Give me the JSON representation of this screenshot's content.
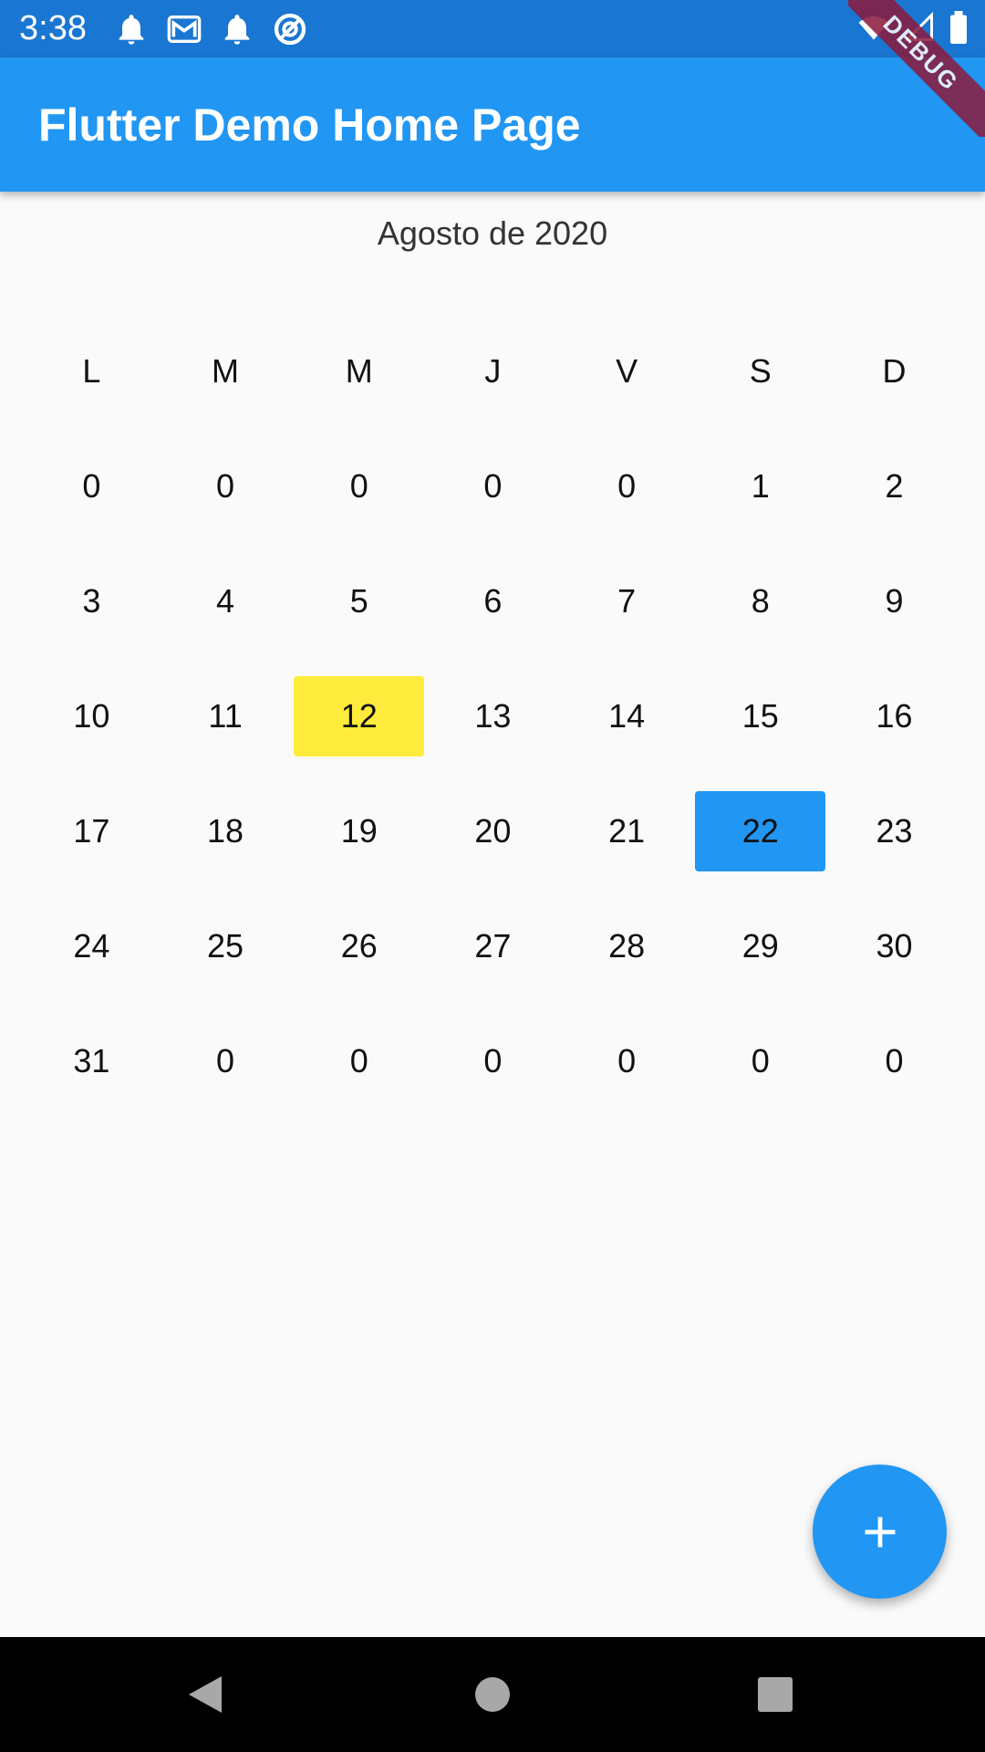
{
  "status_bar": {
    "time": "3:38",
    "left_icons": [
      "notification-bell-icon",
      "gmail-icon",
      "notification-bell-icon",
      "circle-slash-icon"
    ],
    "right_icons": [
      "wifi-icon",
      "signal-icon",
      "battery-icon"
    ]
  },
  "app_bar": {
    "title": "Flutter Demo Home Page"
  },
  "debug_banner": "DEBUG",
  "calendar": {
    "month_title": "Agosto de 2020",
    "weekdays": [
      "L",
      "M",
      "M",
      "J",
      "V",
      "S",
      "D"
    ],
    "weeks": [
      [
        "0",
        "0",
        "0",
        "0",
        "0",
        "1",
        "2"
      ],
      [
        "3",
        "4",
        "5",
        "6",
        "7",
        "8",
        "9"
      ],
      [
        "10",
        "11",
        "12",
        "13",
        "14",
        "15",
        "16"
      ],
      [
        "17",
        "18",
        "19",
        "20",
        "21",
        "22",
        "23"
      ],
      [
        "24",
        "25",
        "26",
        "27",
        "28",
        "29",
        "30"
      ],
      [
        "31",
        "0",
        "0",
        "0",
        "0",
        "0",
        "0"
      ]
    ],
    "highlights": {
      "yellow_day": "12",
      "blue_day": "22"
    }
  },
  "fab": {
    "icon": "plus-icon"
  },
  "nav_bar": {
    "icons": [
      "back-triangle-icon",
      "home-circle-icon",
      "recent-square-icon"
    ]
  },
  "colors": {
    "status_bar": "#1976d2",
    "app_bar": "#2196f3",
    "highlight_yellow": "#ffeb3b",
    "highlight_blue": "#2196f3",
    "background": "#fafafa"
  }
}
